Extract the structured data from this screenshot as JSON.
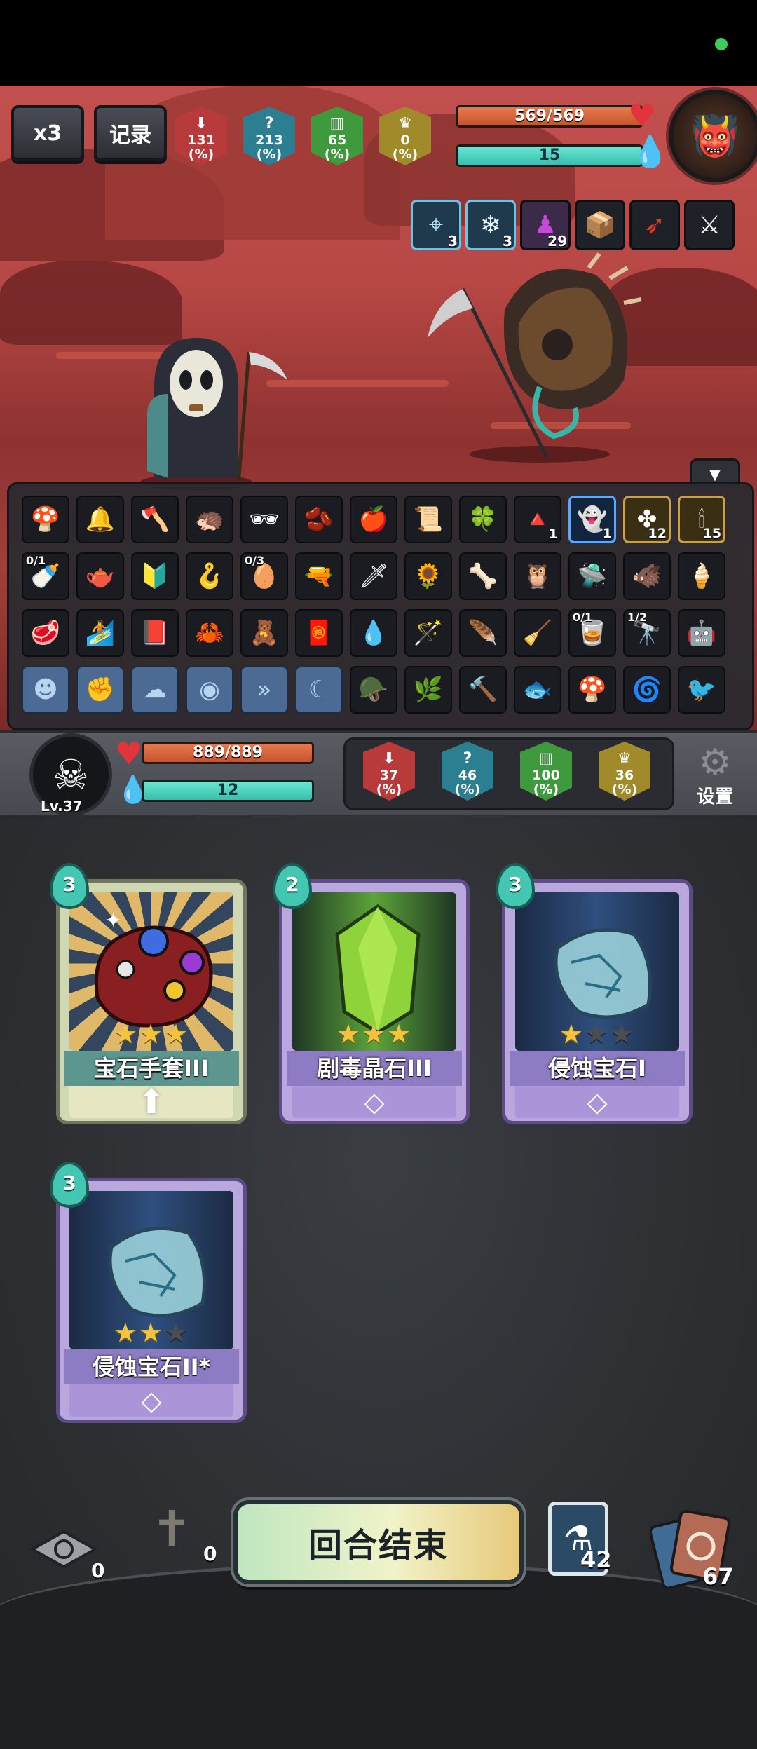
{
  "hud": {
    "speed_label": "x3",
    "record_label": "记录",
    "enemy_stats": [
      {
        "value": "131",
        "unit": "(%)",
        "icon": "attack-down-icon",
        "color": "#b83a3a"
      },
      {
        "value": "213",
        "unit": "(%)",
        "icon": "question-icon",
        "color": "#2c7f91"
      },
      {
        "value": "65",
        "unit": "(%)",
        "icon": "gift-icon",
        "color": "#3f9a3d"
      },
      {
        "value": "0",
        "unit": "(%)",
        "icon": "gold-icon",
        "color": "#a08a2a"
      }
    ],
    "enemy_hp": "569/569",
    "enemy_hp_fraction": 1.0,
    "enemy_energy": "15",
    "enemy_buffs": [
      {
        "icon": "target-icon",
        "count": "3"
      },
      {
        "icon": "snowflake-icon",
        "count": "3"
      },
      {
        "icon": "ghost-portrait-icon",
        "count": "29"
      },
      {
        "icon": "shield-box-icon",
        "count": ""
      },
      {
        "icon": "red-gun-icon",
        "count": ""
      },
      {
        "icon": "claw-icon",
        "count": ""
      }
    ]
  },
  "inventory": {
    "rows": [
      [
        {
          "icon": "🍄"
        },
        {
          "icon": "🔔"
        },
        {
          "icon": "🪓"
        },
        {
          "icon": "🦔"
        },
        {
          "icon": "🕶"
        },
        {
          "icon": "🫘"
        },
        {
          "icon": "🍎"
        },
        {
          "icon": "📜"
        },
        {
          "icon": "🍀"
        },
        {
          "icon": "🔺",
          "count": "1"
        },
        {
          "icon": "👻",
          "count": "1",
          "style": "blue"
        },
        {
          "icon": "✤",
          "count": "12",
          "style": "rare"
        },
        {
          "icon": "🕯",
          "count": "15",
          "style": "rare"
        }
      ],
      [
        {
          "icon": "🍼",
          "frac": "0/1"
        },
        {
          "icon": "🫖"
        },
        {
          "icon": "🔰"
        },
        {
          "icon": "🪝"
        },
        {
          "icon": "🥚",
          "frac": "0/3"
        },
        {
          "icon": "🔫"
        },
        {
          "icon": "🗡"
        },
        {
          "icon": "🌻"
        },
        {
          "icon": "🦴"
        },
        {
          "icon": "🦉"
        },
        {
          "icon": "🛸"
        },
        {
          "icon": "🐗"
        },
        {
          "icon": "🍦"
        }
      ],
      [
        {
          "icon": "🥩"
        },
        {
          "icon": "🏄"
        },
        {
          "icon": "📕"
        },
        {
          "icon": "🦀"
        },
        {
          "icon": "🧸"
        },
        {
          "icon": "🧧"
        },
        {
          "icon": "💧"
        },
        {
          "icon": "🪄"
        },
        {
          "icon": "🪶"
        },
        {
          "icon": "🧹"
        },
        {
          "icon": "🥃",
          "frac": "0/1"
        },
        {
          "icon": "🔭",
          "frac": "1/2"
        },
        {
          "icon": "🤖"
        }
      ],
      [
        {
          "icon": "☻",
          "style": "ghost"
        },
        {
          "icon": "✊",
          "style": "ghost"
        },
        {
          "icon": "☁",
          "style": "ghost"
        },
        {
          "icon": "◉",
          "style": "ghost"
        },
        {
          "icon": "»",
          "style": "ghost"
        },
        {
          "icon": "☾",
          "style": "ghost"
        },
        {
          "icon": "🪖"
        },
        {
          "icon": "🌿"
        },
        {
          "icon": "🔨"
        },
        {
          "icon": "🐟"
        },
        {
          "icon": "🍄"
        },
        {
          "icon": "🌀"
        },
        {
          "icon": "🐦"
        }
      ]
    ]
  },
  "player": {
    "level": "Lv.37",
    "hp": "889/889",
    "hp_fraction": 1.0,
    "energy": "12",
    "stats": [
      {
        "value": "37",
        "unit": "(%)",
        "icon": "attack-down-icon",
        "color": "#b83a3a"
      },
      {
        "value": "46",
        "unit": "(%)",
        "icon": "question-icon",
        "color": "#2c7f91"
      },
      {
        "value": "100",
        "unit": "(%)",
        "icon": "gift-icon",
        "color": "#3f9a3d"
      },
      {
        "value": "36",
        "unit": "(%)",
        "icon": "gold-icon",
        "color": "#a08a2a"
      }
    ],
    "settings_label": "设置"
  },
  "cards": [
    {
      "name": "宝石手套III",
      "cost": "3",
      "stars": 3,
      "max_stars": 3,
      "rarity": "gold",
      "foot_icon": "arrow-up-icon",
      "art": "gauntlet"
    },
    {
      "name": "剧毒晶石III",
      "cost": "2",
      "stars": 3,
      "max_stars": 3,
      "rarity": "purple",
      "foot_icon": "diamond-icon",
      "art": "green-crystal"
    },
    {
      "name": "侵蚀宝石I",
      "cost": "3",
      "stars": 1,
      "max_stars": 3,
      "rarity": "purple",
      "foot_icon": "diamond-icon",
      "art": "blue-stone"
    },
    {
      "name": "侵蚀宝石II*",
      "cost": "3",
      "stars": 2,
      "max_stars": 3,
      "rarity": "purple",
      "foot_icon": "diamond-icon",
      "art": "blue-stone"
    }
  ],
  "bottom": {
    "discard_count": "0",
    "grave_count": "0",
    "end_turn_label": "回合结束",
    "potion_count": "42",
    "deck_count": "67"
  }
}
